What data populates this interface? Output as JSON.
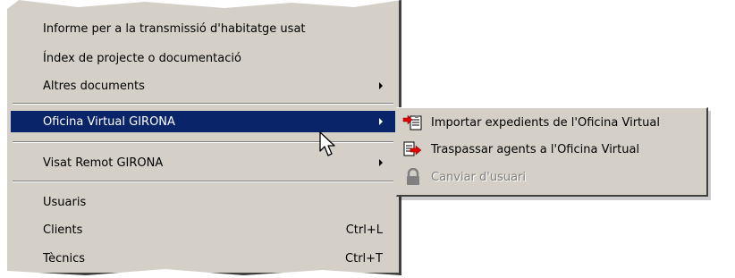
{
  "main_menu": {
    "items": [
      {
        "label": "Informe per a la transmissió d'habitatge usat"
      },
      {
        "label": "Índex de projecte o documentació"
      },
      {
        "label": "Altres documents"
      },
      {
        "label": "Oficina Virtual GIRONA"
      },
      {
        "label": "Visat Remot GIRONA"
      },
      {
        "label": "Usuaris"
      },
      {
        "label": "Clients",
        "shortcut": "Ctrl+L"
      },
      {
        "label": "Tècnics",
        "shortcut": "Ctrl+T"
      }
    ]
  },
  "submenu": {
    "items": [
      {
        "label": "Importar expedients de l'Oficina Virtual",
        "icon": "import-document-icon"
      },
      {
        "label": "Traspassar agents a l'Oficina Virtual",
        "icon": "transfer-document-icon"
      },
      {
        "label": "Canviar d'usuari",
        "icon": "lock-icon",
        "disabled": true
      }
    ]
  },
  "colors": {
    "menu_background": "#d4d0c8",
    "highlight": "#0a246a",
    "disabled_text": "#808080"
  }
}
